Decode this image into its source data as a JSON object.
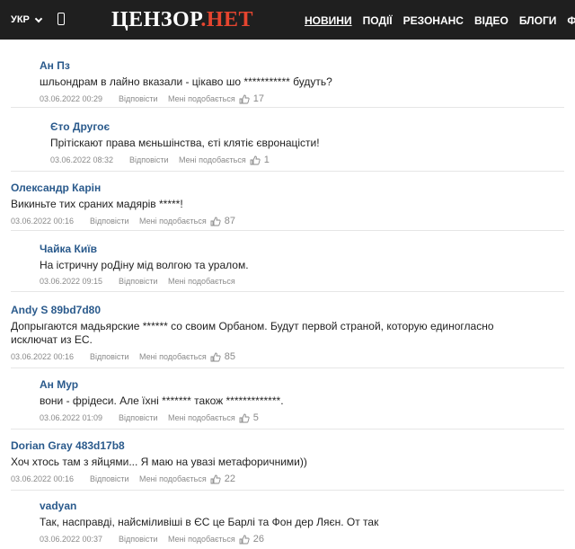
{
  "header": {
    "lang": "УКР",
    "logo_main": "ЦЕНЗОР",
    "logo_dot": ".",
    "logo_net": "НЕТ",
    "nav": [
      "НОВИНИ",
      "ПОДІЇ",
      "РЕЗОНАНС",
      "ВІДЕО",
      "БЛОГИ",
      "ФО"
    ]
  },
  "colors": {
    "header_bg": "#1f1f1f",
    "accent": "#e6452f",
    "author": "#2a5a8c"
  },
  "labels": {
    "reply": "Відповісти",
    "like": "Мені подобається"
  },
  "comments": [
    {
      "author": "Ан Пз",
      "text": "шльондрам в лайно вказали - цікаво шо *********** будуть?",
      "date": "03.06.2022 00:29",
      "likes": "17"
    },
    {
      "author": "Єто Другоє",
      "text": "Прітіскают права мєньшінства, єті клятіє євронацісти!",
      "date": "03.06.2022 08:32",
      "likes": "1"
    },
    {
      "author": "Олександр Карін",
      "text": "Викиньте тих сраних мадярів *****!",
      "date": "03.06.2022 00:16",
      "likes": "87"
    },
    {
      "author": "Чайка Київ",
      "text": "На істричну роДіну мід волгою та уралом.",
      "date": "03.06.2022 09:15",
      "likes": ""
    },
    {
      "author": "Andy S 89bd7d80",
      "text": "Допрыгаются мадьярские ****** со своим Орбаном. Будут первой страной, которую единогласно исключат из ЕС.",
      "date": "03.06.2022 00:16",
      "likes": "85"
    },
    {
      "author": "Ан Мур",
      "text": "вони - фрідеси. Але їхні ******* також *************.",
      "date": "03.06.2022 01:09",
      "likes": "5"
    },
    {
      "author": "Dorian Gray 483d17b8",
      "text": "Хоч хтось там з яйцями... Я маю на увазі метафоричними))",
      "date": "03.06.2022 00:16",
      "likes": "22"
    },
    {
      "author": "vadyan",
      "text": "Так, насправді, найсміливіші в ЄС це Барлі та Фон дер Ляєн. От так",
      "date": "03.06.2022 00:37",
      "likes": "26"
    }
  ]
}
